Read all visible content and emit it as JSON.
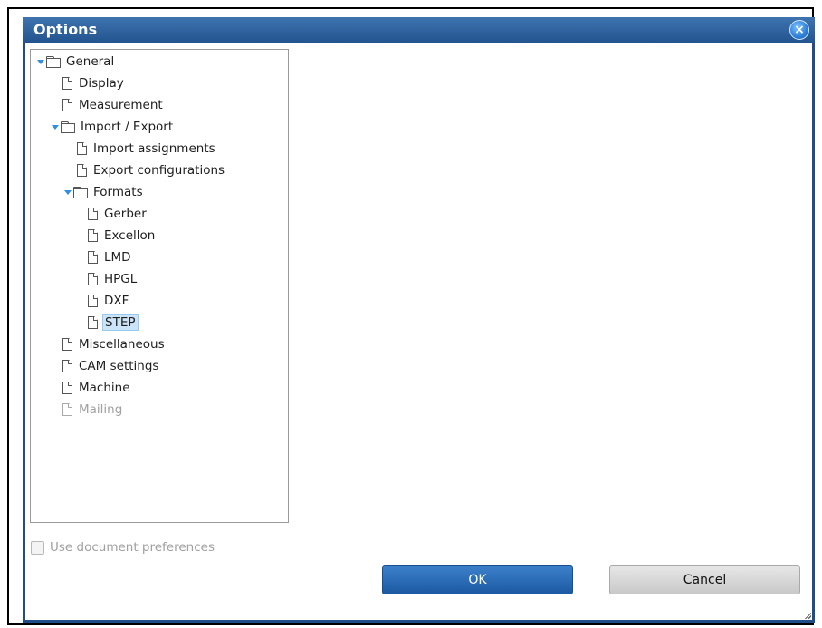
{
  "window": {
    "title": "Options",
    "close_symbol": "×"
  },
  "tree": {
    "items": [
      {
        "label": "General",
        "type": "folder",
        "expanded": true
      },
      {
        "label": "Display",
        "type": "page"
      },
      {
        "label": "Measurement",
        "type": "page"
      },
      {
        "label": "Import / Export",
        "type": "folder",
        "expanded": true
      },
      {
        "label": "Import assignments",
        "type": "page"
      },
      {
        "label": "Export configurations",
        "type": "page"
      },
      {
        "label": "Formats",
        "type": "folder",
        "expanded": true
      },
      {
        "label": "Gerber",
        "type": "page"
      },
      {
        "label": "Excellon",
        "type": "page"
      },
      {
        "label": "LMD",
        "type": "page"
      },
      {
        "label": "HPGL",
        "type": "page"
      },
      {
        "label": "DXF",
        "type": "page"
      },
      {
        "label": "STEP",
        "type": "page",
        "selected": true
      },
      {
        "label": "Miscellaneous",
        "type": "page"
      },
      {
        "label": "CAM settings",
        "type": "page"
      },
      {
        "label": "Machine",
        "type": "page"
      },
      {
        "label": "Mailing",
        "type": "page",
        "disabled": true
      }
    ]
  },
  "preferences": {
    "use_document_label": "Use document preferences",
    "checked": false,
    "enabled": false
  },
  "buttons": {
    "ok_label": "OK",
    "cancel_label": "Cancel"
  },
  "colors": {
    "title_bar": "#23548f",
    "selection": "#cce4f7",
    "ok_button": "#1b5aa3",
    "expander_arrow": "#2f8fe0"
  }
}
